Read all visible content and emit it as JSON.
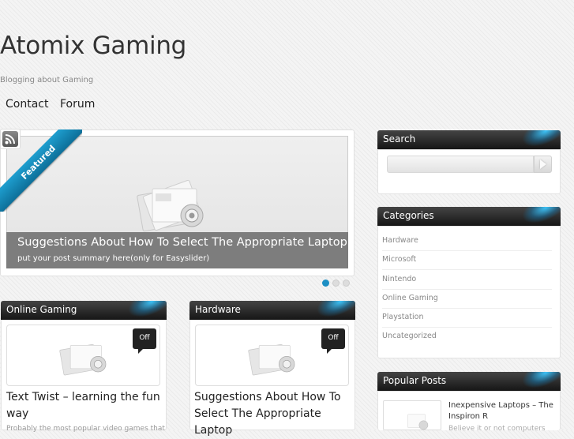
{
  "site": {
    "title": "Atomix Gaming",
    "tagline": "Blogging about Gaming"
  },
  "nav": {
    "items": [
      {
        "label": "Contact"
      },
      {
        "label": "Forum"
      }
    ]
  },
  "featured": {
    "ribbon": "Featured",
    "slide": {
      "title": "Suggestions About How To Select The Appropriate Laptop",
      "summary": "put your post summary here(only for Easyslider)"
    },
    "slide_count": 3,
    "active_slide": 1,
    "accent_color": "#1a8fc0"
  },
  "categories_sections": [
    {
      "heading": "Online Gaming",
      "comments_badge": "Off",
      "post_title": "Text Twist – learning the fun way",
      "excerpt": "Probably the most popular video games that"
    },
    {
      "heading": "Hardware",
      "comments_badge": "Off",
      "post_title": "Suggestions About How To Select The Appropriate Laptop",
      "excerpt": ""
    }
  ],
  "sidebar": {
    "search": {
      "heading": "Search",
      "value": "",
      "button_icon": "arrow-right-icon"
    },
    "categories": {
      "heading": "Categories",
      "items": [
        {
          "label": "Hardware"
        },
        {
          "label": "Microsoft"
        },
        {
          "label": "Nintendo"
        },
        {
          "label": "Online Gaming"
        },
        {
          "label": "Playstation"
        },
        {
          "label": "Uncategorized"
        }
      ]
    },
    "popular": {
      "heading": "Popular Posts",
      "posts": [
        {
          "title": "Inexpensive Laptops – The Inspiron R",
          "excerpt": "Believe it or not computers"
        }
      ]
    }
  },
  "icons": {
    "rss": "rss-icon",
    "placeholder": "image-placeholder-icon"
  }
}
